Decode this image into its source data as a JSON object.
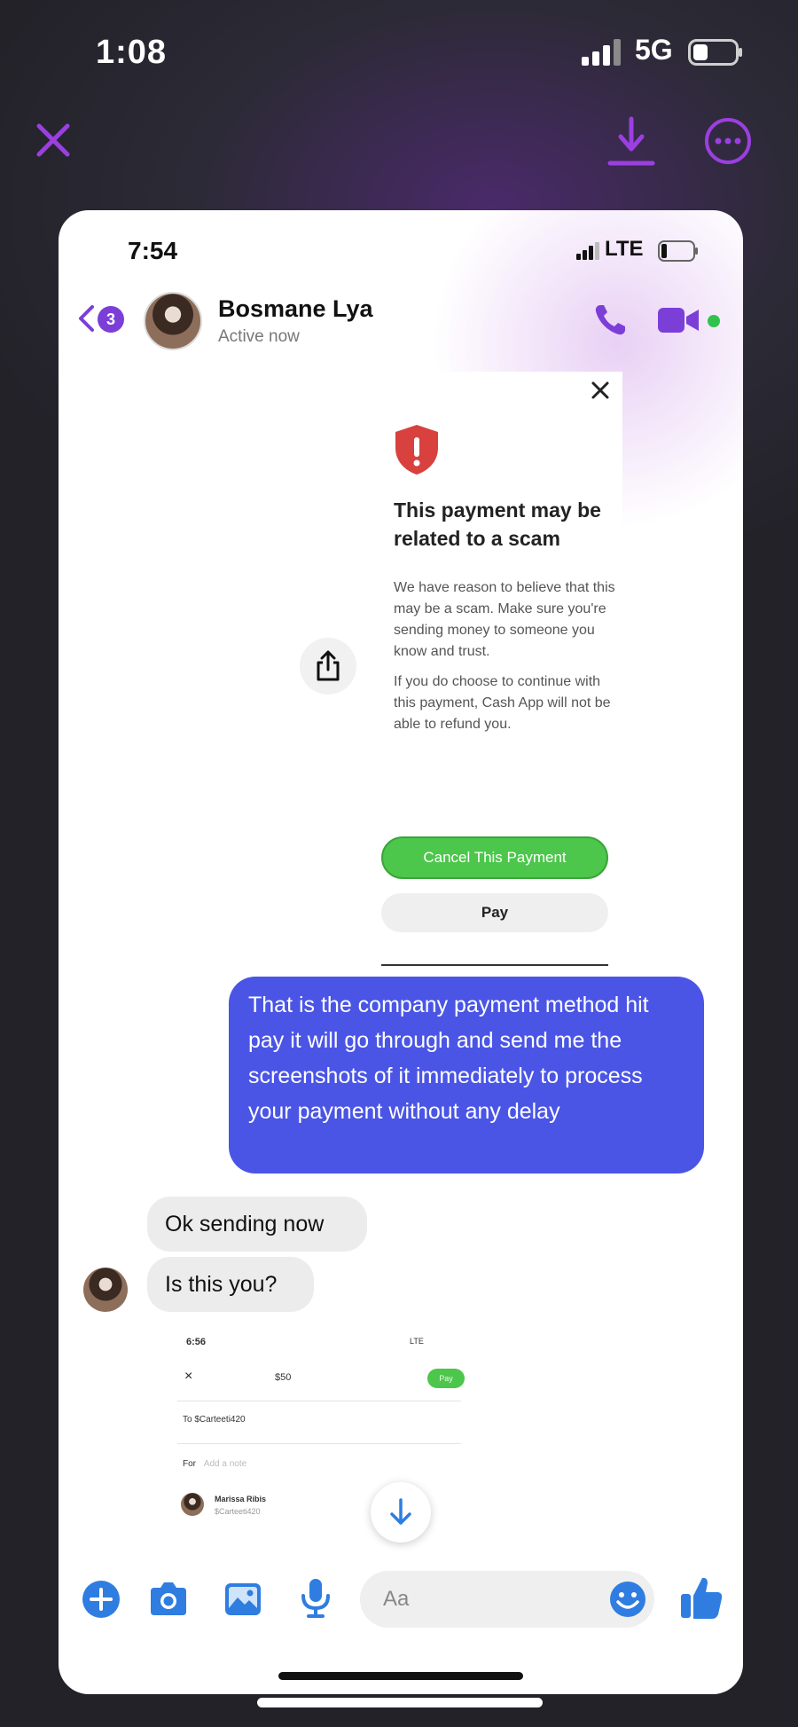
{
  "outer_status": {
    "time": "1:08",
    "network": "5G"
  },
  "viewer_toolbar": {
    "close_icon": "close-icon",
    "download_icon": "download-icon",
    "more_icon": "more-options-icon",
    "accent_color": "#9b3fe0"
  },
  "inner_status": {
    "time": "7:54",
    "network": "LTE"
  },
  "chat_header": {
    "back_badge": "3",
    "contact_name": "Bosmane Lya",
    "contact_status": "Active now",
    "accent_color": "#7b3fd8"
  },
  "scam_warning": {
    "title": "This payment may be related to a scam",
    "body1": "We have reason to believe that this may be a scam. Make sure you're sending money to someone you know and trust.",
    "body2": "If you do choose to continue with this payment, Cash App will not be able to refund you.",
    "cancel_label": "Cancel This Payment",
    "pay_label": "Pay",
    "cancel_color": "#4cc64b",
    "shield_color": "#d9413f"
  },
  "messages": [
    {
      "direction": "outgoing",
      "text": "That is the company payment method hit pay it will go through and send me the screenshots of it immediately to process your payment without any delay"
    },
    {
      "direction": "incoming",
      "text": "Ok sending now"
    },
    {
      "direction": "incoming",
      "text": "Is this you?"
    }
  ],
  "attachment": {
    "time": "6:56",
    "status": "LTE",
    "amount": "$50",
    "pay_label": "Pay",
    "to_label": "To",
    "to_value": "$Carteeti420",
    "for_label": "For",
    "for_placeholder": "Add a note",
    "recipient_name": "Marissa Ribis",
    "recipient_handle": "$Carteeti420"
  },
  "composer": {
    "placeholder": "Aa"
  },
  "colors": {
    "outgoing_bubble": "#4a55e6",
    "incoming_bubble": "#ececec",
    "messenger_blue": "#2f7de1"
  }
}
